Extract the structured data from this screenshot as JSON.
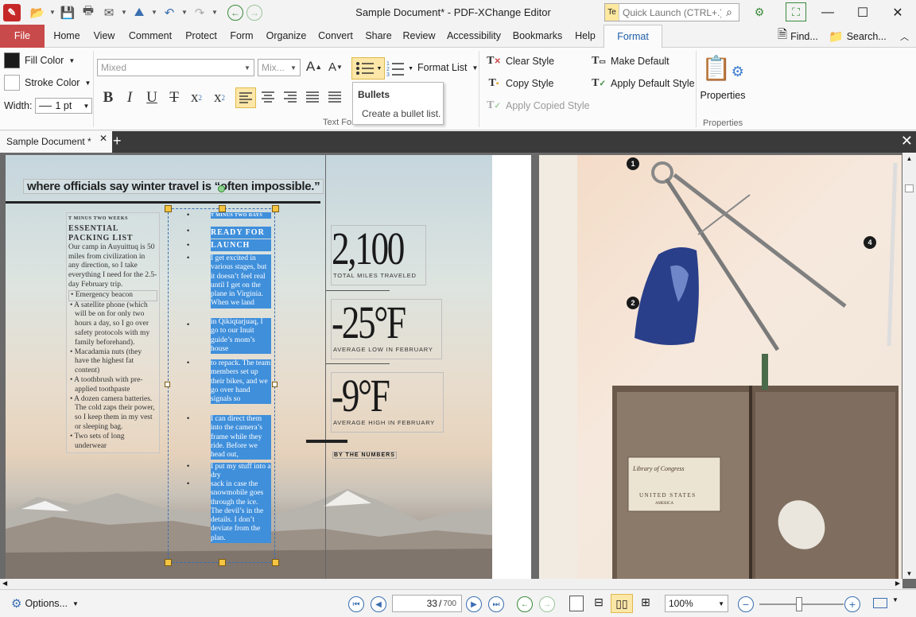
{
  "window": {
    "title": "Sample Document* - PDF-XChange Editor",
    "quick_launch_tag": "Te",
    "quick_launch_placeholder": "Quick Launch (CTRL+.)"
  },
  "menu": {
    "tabs": [
      "File",
      "Home",
      "View",
      "Comment",
      "Protect",
      "Form",
      "Organize",
      "Convert",
      "Share",
      "Review",
      "Accessibility",
      "Bookmarks",
      "Help",
      "Format"
    ],
    "find": "Find...",
    "search": "Search..."
  },
  "ribbon": {
    "fill_color": "Fill Color",
    "stroke_color": "Stroke Color",
    "width_label": "Width:",
    "width_value": "1 pt",
    "font_value": "Mixed",
    "size_value": "Mix...",
    "format_list": "Format List",
    "clear_style": "Clear Style",
    "copy_style": "Copy Style",
    "apply_copied_style": "Apply Copied Style",
    "make_default": "Make Default",
    "apply_default_style": "Apply Default Style",
    "properties": "Properties",
    "group_text_format": "Text Format",
    "group_properties": "Properties",
    "fmt_buttons": [
      "B",
      "I",
      "U",
      "T",
      "x",
      "x"
    ]
  },
  "tooltip": {
    "title": "Bullets",
    "body": "Create a bullet list."
  },
  "doc_tab": {
    "label": "Sample Document *"
  },
  "page": {
    "headline": "where officials say winter travel is “often impossible.”",
    "sidebar": {
      "kicker": "T MINUS TWO WEEKS",
      "head1": "ESSENTIAL",
      "head2": "PACKING LIST",
      "intro": "Our camp in Auyuittuq is 50 miles from civilization in any direction, so I take everything I need for the 2.5-day February trip.",
      "items": [
        "• Emergency beacon",
        "• A satellite phone (which will be on for only two hours a day, so I go over safety protocols with my family beforehand).",
        "• Macadamia nuts (they have the highest fat content)",
        "• A toothbrush with pre-applied toothpaste",
        "• A dozen camera batteries. The cold zaps their power, so I keep them in my vest or sleeping bag.",
        "• Two sets of long underwear"
      ]
    },
    "column": {
      "kicker": "T MINUS TWO DAYS",
      "head1": "READY FOR",
      "head2": "LAUNCH",
      "p1": "I get excited in various stages, but it doesn’t feel real until I get on the plane in Virginia. When we land",
      "p2": "in Qikiqtarjuaq, I go to our Inuit guide’s mom’s house",
      "p3": "to repack. The team members set up their bikes, and we go over hand signals so",
      "p4": "I can direct them into the camera’s frame while they ride. Before we head out,",
      "p5": "I put my stuff into a dry",
      "p6": "sack in case the snowmobile goes through the ice. The devil’s in the details. I don’t deviate from the plan."
    },
    "stats": [
      {
        "num": "2,100",
        "cap": "TOTAL MILES TRAVELED"
      },
      {
        "num": "-25°F",
        "cap": "AVERAGE LOW IN FEBRUARY"
      },
      {
        "num": "-9°F",
        "cap": "AVERAGE HIGH IN FEBRUARY"
      }
    ],
    "by_numbers": "BY THE NUMBERS",
    "pins": [
      "1",
      "2",
      "4"
    ],
    "book_label1": "Library of Congress",
    "book_label2": "UNITED STATES",
    "book_label3": "AMERICA"
  },
  "statusbar": {
    "options": "Options...",
    "page_current": "33",
    "page_total": "700",
    "zoom": "100%"
  },
  "colors": {
    "file_tab": "#c94a4a",
    "selection": "#3f8fdb",
    "accent": "#3a6fb0"
  }
}
